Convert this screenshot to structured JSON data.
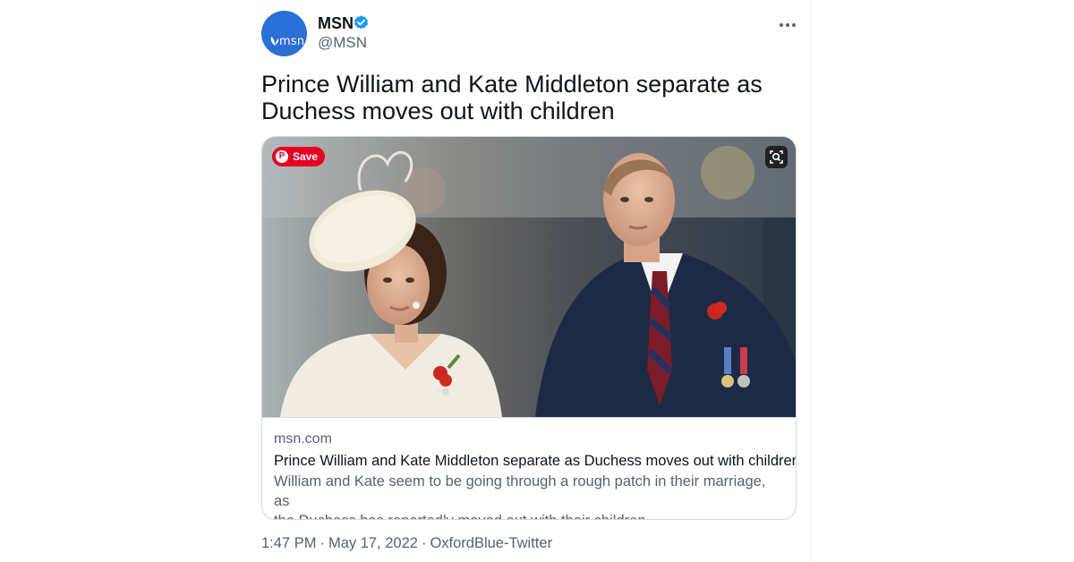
{
  "tweet": {
    "author": {
      "display_name": "MSN",
      "handle": "@MSN",
      "avatar_logo_text": "msn",
      "verified": true,
      "verified_color": "#1d9bf0"
    },
    "text": "Prince William and Kate Middleton separate as Duchess moves out with children",
    "more_icon": "more-horizontal-icon"
  },
  "card": {
    "save_label": "Save",
    "save_icon": "pinterest-icon",
    "lens_icon": "visual-search-icon",
    "domain": "msn.com",
    "title": "Prince William and Kate Middleton separate as Duchess moves out with children",
    "description_line1": "William and Kate seem to be going through a rough patch in their marriage, as",
    "description_line2": "the Duchess has reportedly moved out with their children."
  },
  "meta": {
    "time": "1:47 PM",
    "date": "May 17, 2022",
    "source": "OxfordBlue-Twitter",
    "separator": "·"
  },
  "colors": {
    "brand_blue": "#2a6fd6",
    "pinterest_red": "#e60023",
    "text_primary": "#0f1419",
    "text_secondary": "#536471",
    "border": "#cfd9de"
  }
}
